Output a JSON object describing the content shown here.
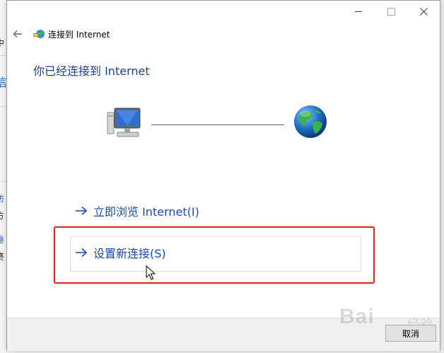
{
  "window": {
    "title": "连接到 Internet",
    "icons": [
      "back-arrow-icon",
      "network-wizard-icon",
      "minimize-icon",
      "maximize-icon",
      "close-icon"
    ]
  },
  "background_window": {
    "texts": [
      "中",
      "信",
      "访",
      "方",
      "卷",
      "终"
    ]
  },
  "content": {
    "heading": "你已经连接到 Internet",
    "diagram": {
      "left_icon": "computer-icon",
      "right_icon": "globe-icon"
    },
    "options": [
      {
        "label": "立即浏览 Internet(I)"
      },
      {
        "label": "设置新连接(S)"
      }
    ]
  },
  "footer": {
    "cancel_label": "取消"
  },
  "watermark": {
    "text": "Bai",
    "sub": "经验"
  },
  "colors": {
    "heading": "#1c3f9e",
    "link": "#1c47b3",
    "highlight": "#e02525"
  }
}
